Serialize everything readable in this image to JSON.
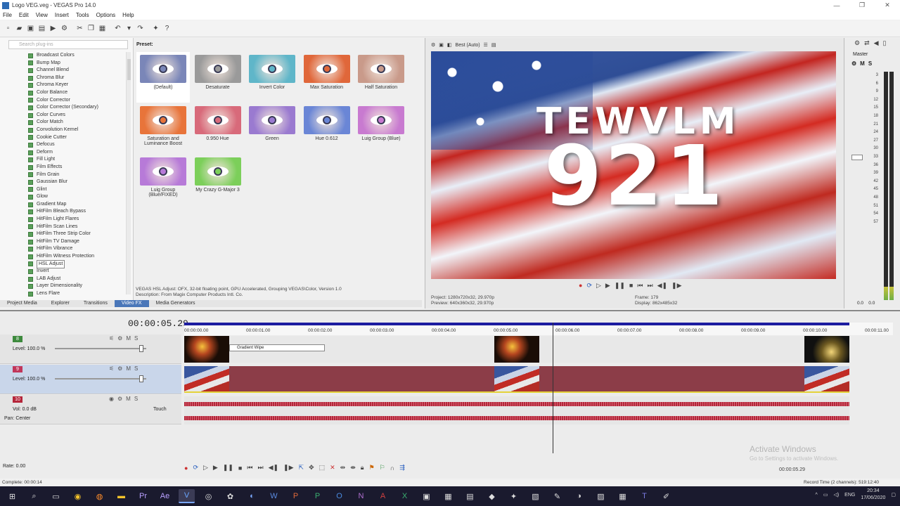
{
  "window": {
    "title": "Logo VEG.veg - VEGAS Pro 14.0",
    "controls": [
      "—",
      "❐",
      "✕"
    ]
  },
  "menu": [
    "File",
    "Edit",
    "View",
    "Insert",
    "Tools",
    "Options",
    "Help"
  ],
  "plugins": {
    "search_placeholder": "Search plug-ins",
    "items": [
      "Broadcast Colors",
      "Bump Map",
      "Channel Blend",
      "Chroma Blur",
      "Chroma Keyer",
      "Color Balance",
      "Color Corrector",
      "Color Corrector (Secondary)",
      "Color Curves",
      "Color Match",
      "Convolution Kernel",
      "Cookie Cutter",
      "Defocus",
      "Deform",
      "Fill Light",
      "Film Effects",
      "Film Grain",
      "Gaussian Blur",
      "Glint",
      "Glow",
      "Gradient Map",
      "HitFilm Bleach Bypass",
      "HitFilm Light Flares",
      "HitFilm Scan Lines",
      "HitFilm Three Strip Color",
      "HitFilm TV Damage",
      "HitFilm Vibrance",
      "HitFilm Witness Protection",
      "HSL Adjust",
      "Invert",
      "LAB Adjust",
      "Layer Dimensionality",
      "Lens Flare"
    ],
    "selected": "HSL Adjust"
  },
  "presets": {
    "header": "Preset:",
    "items": [
      {
        "label": "(Default)",
        "color": "#7a86b8"
      },
      {
        "label": "Desaturate",
        "color": "#9a9a9a"
      },
      {
        "label": "Invert Color",
        "color": "#5fb6c9"
      },
      {
        "label": "Max Saturation",
        "color": "#e0673a"
      },
      {
        "label": "Half Saturation",
        "color": "#c99a8a"
      },
      {
        "label": "Saturation and Luminance Boost",
        "color": "#e8743a"
      },
      {
        "label": "0.950 Hue",
        "color": "#d86a7a"
      },
      {
        "label": "Green",
        "color": "#9a7ad0"
      },
      {
        "label": "Hue 0.612",
        "color": "#6a86d6"
      },
      {
        "label": "Luig Group (Blue)",
        "color": "#c87ad0"
      },
      {
        "label": "Luig Group (Blue/FIXED)",
        "color": "#b77ad8"
      },
      {
        "label": "My Crazy G-Major 3",
        "color": "#7ccf5a"
      }
    ],
    "description_line1": "VEGAS HSL Adjust: OFX, 32-bit floating point, GPU Accelerated, Grouping VEGAS\\Color, Version 1.0",
    "description_line2": "Description: From Magix Computer Products Intl. Co."
  },
  "lower_tabs": [
    "Project Media",
    "Explorer",
    "Transitions",
    "Video FX",
    "Media Generators"
  ],
  "lower_tabs_active": "Video FX",
  "preview": {
    "quality": "Best (Auto)",
    "overlay_line1": "TEWVLM",
    "overlay_line2": "921",
    "project_label": "Project:",
    "project_value": "1280x720x32, 29.970p",
    "preview_label": "Preview:",
    "preview_value": "640x360x32, 29.970p",
    "frame_label": "Frame:",
    "frame_value": "179",
    "display_label": "Display:",
    "display_value": "862x485x32"
  },
  "master": {
    "label": "Master",
    "scale": [
      "3",
      "6",
      "9",
      "12",
      "15",
      "18",
      "21",
      "24",
      "27",
      "30",
      "33",
      "36",
      "39",
      "42",
      "45",
      "48",
      "51",
      "54",
      "57"
    ],
    "readout_left": "0.0",
    "readout_right": "0.0"
  },
  "timeline": {
    "timecode": "00:00:05.29",
    "ruler_ticks": [
      "00:00:00.00",
      "00:00:01.00",
      "00:00:02.00",
      "00:00:03.00",
      "00:00:04.00",
      "00:00:05.00",
      "00:00:06.00",
      "00:00:07.00",
      "00:00:08.00",
      "00:00:09.00",
      "00:00:10.00",
      "00:00:11.00"
    ],
    "tracks": [
      {
        "num": "8",
        "level_label": "Level: 100.0 %",
        "color": "#3d8a3d"
      },
      {
        "num": "9",
        "level_label": "Level: 100.0 %",
        "color": "#c0365a"
      },
      {
        "num": "10",
        "vol_label": "Vol:",
        "vol_value": "0.0 dB",
        "pan_label": "Pan:",
        "pan_value": "Center",
        "touch": "Touch",
        "color": "#b5263a"
      }
    ],
    "gradient_wipe_label": "Gradient Wipe",
    "rate": "Rate: 0.00",
    "cursor_time": "00:00:05.29",
    "activate_title": "Activate Windows",
    "activate_sub": "Go to Settings to activate Windows."
  },
  "status": {
    "left": "Complete: 00:00:14",
    "right": "Record Time (2 channels): 519:12:40"
  },
  "taskbar": {
    "lang": "ENG",
    "time": "20:34",
    "date": "17/06/2020"
  }
}
